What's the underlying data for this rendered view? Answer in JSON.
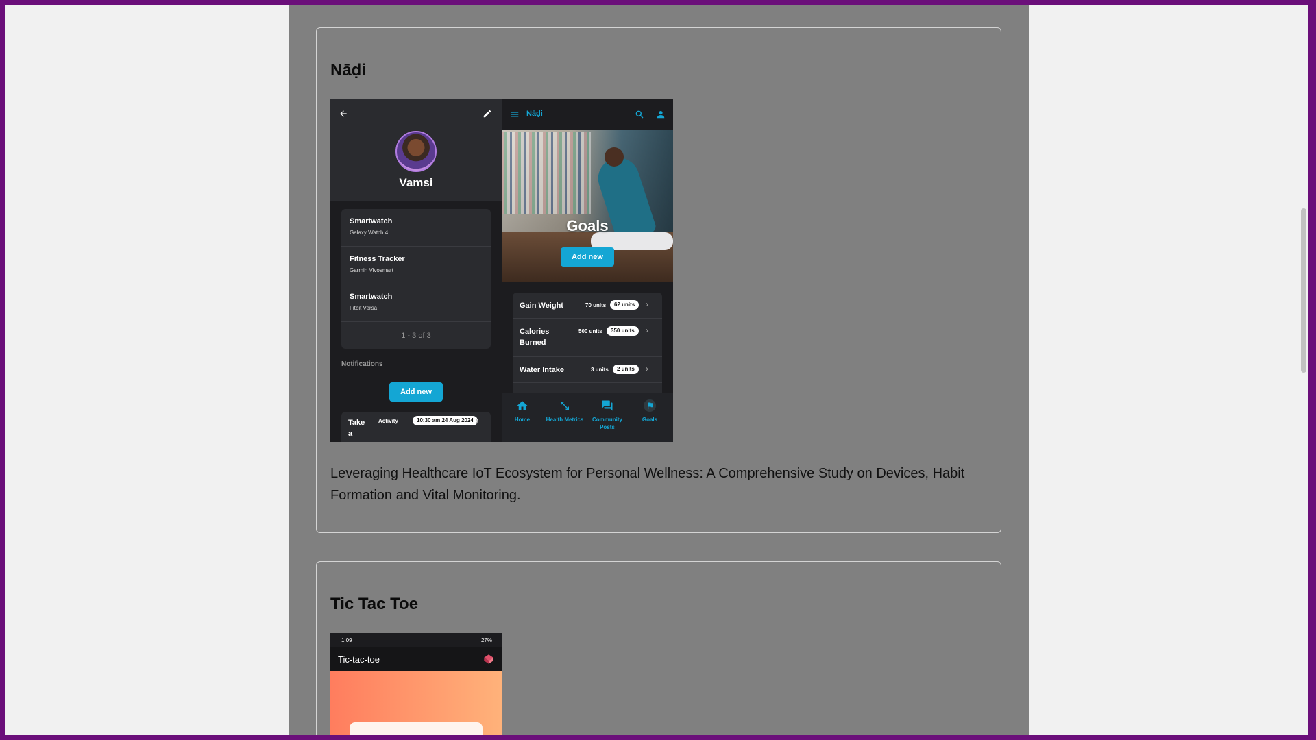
{
  "projects": [
    {
      "title": "Nāḍi",
      "description": "Leveraging Healthcare IoT Ecosystem for Personal Wellness: A Comprehensive Study on Devices, Habit Formation and Vital Monitoring.",
      "screenshot_profile": {
        "user_name": "Vamsi",
        "devices": [
          {
            "title": "Smartwatch",
            "subtitle": "Galaxy Watch 4"
          },
          {
            "title": "Fitness Tracker",
            "subtitle": "Garmin Vivosmart"
          },
          {
            "title": "Smartwatch",
            "subtitle": "Fitbit Versa"
          }
        ],
        "pager": "1 - 3 of 3",
        "notifications_label": "Notifications",
        "add_new_label": "Add new",
        "notification": {
          "title": "Take a",
          "type": "Activity",
          "time": "10:30 am 24 Aug 2024"
        }
      },
      "screenshot_goals": {
        "app_title": "Nāḍi",
        "hero_title": "Goals",
        "add_new_label": "Add new",
        "goals": [
          {
            "name": "Gain Weight",
            "target": "70 units",
            "current": "62 units"
          },
          {
            "name": "Calories Burned",
            "target": "500 units",
            "current": "350 units"
          },
          {
            "name": "Water Intake",
            "target": "3 units",
            "current": "2 units"
          }
        ],
        "nav": [
          {
            "label": "Home",
            "icon": "home-icon"
          },
          {
            "label": "Health Metrics",
            "icon": "metrics-icon"
          },
          {
            "label": "Community Posts",
            "icon": "forum-icon"
          },
          {
            "label": "Goals",
            "icon": "flag-icon"
          }
        ],
        "accent_color": "#14a6d4"
      }
    },
    {
      "title": "Tic Tac Toe",
      "screenshot": {
        "status_time": "1:09",
        "status_right": "27%",
        "app_title": "Tic-tac-toe"
      }
    }
  ]
}
